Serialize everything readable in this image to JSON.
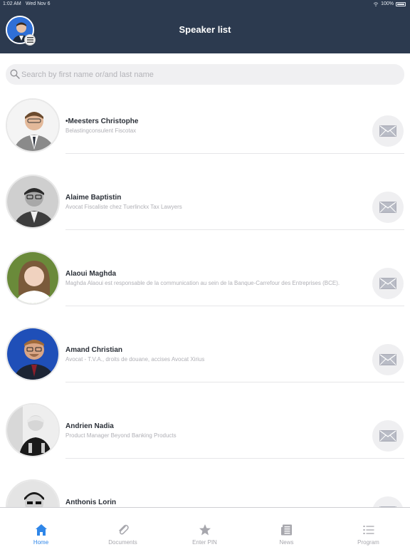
{
  "status_bar": {
    "time": "1:02 AM",
    "date": "Wed Nov 6",
    "battery": "100%"
  },
  "header": {
    "title": "Speaker list"
  },
  "search": {
    "placeholder": "Search by first name or/and last name"
  },
  "speakers": [
    {
      "name": "•Meesters Christophe",
      "role": "Belastingconsulent Fiscotax",
      "icon": "mail-icon"
    },
    {
      "name": "Alaime Baptistin",
      "role": "Avocat Fiscaliste chez Tuerlinckx Tax Lawyers",
      "icon": "mail-icon"
    },
    {
      "name": "Alaoui Maghda",
      "role": "Maghda Alaoui est responsable de la communication au sein de la  Banque-Carrefour des Entreprises (BCE).",
      "icon": "mail-icon"
    },
    {
      "name": "Amand Christian",
      "role": "Avocat - T.V.A., droits de douane, accises Avocat Xirius",
      "icon": "mail-icon"
    },
    {
      "name": "Andrien Nadia",
      "role": "Product Manager Beyond Banking Products",
      "icon": "mail-icon"
    },
    {
      "name": "Anthonis Lorin",
      "role": "",
      "icon": "mail-icon"
    }
  ],
  "tabs": [
    {
      "label": "Home",
      "icon": "home-icon",
      "active": true
    },
    {
      "label": "Documents",
      "icon": "paperclip-icon",
      "active": false
    },
    {
      "label": "Enter PIN",
      "icon": "star-icon",
      "active": false
    },
    {
      "label": "News",
      "icon": "newspaper-icon",
      "active": false
    },
    {
      "label": "Program",
      "icon": "list-icon",
      "active": false
    }
  ],
  "colors": {
    "header_bg": "#2c3a4f",
    "accent": "#2f86e8",
    "tab_inactive": "#a7a7ad"
  }
}
